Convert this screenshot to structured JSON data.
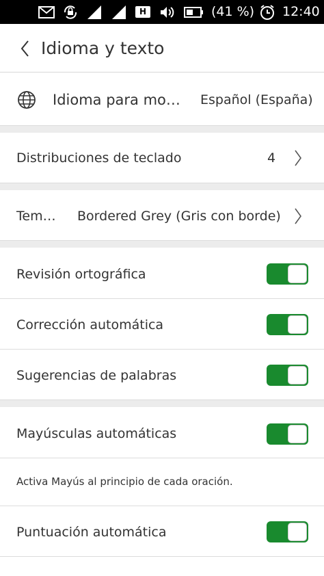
{
  "status_bar": {
    "icons": [
      "mail-icon",
      "rotation-lock-icon",
      "signal-icon",
      "signal-icon",
      "h-network-icon",
      "volume-icon",
      "battery-icon",
      "alarm-icon"
    ],
    "network_badge": "H",
    "battery_text": "(41 %)",
    "time": "12:40"
  },
  "header": {
    "title": "Idioma y texto"
  },
  "display_language": {
    "label": "Idioma para mo…",
    "value": "Español (España)",
    "icon": "globe-icon"
  },
  "keyboard_layouts": {
    "label": "Distribuciones de teclado",
    "count": "4"
  },
  "theme": {
    "label": "Tem…",
    "value": "Bordered Grey (Gris con borde)"
  },
  "toggles": {
    "spell_check": {
      "label": "Revisión ortográfica",
      "on": true
    },
    "auto_correction": {
      "label": "Corrección automática",
      "on": true
    },
    "word_suggestions": {
      "label": "Sugerencias de palabras",
      "on": true
    },
    "auto_caps": {
      "label": "Mayúsculas automáticas",
      "on": true,
      "description": "Activa Mayús al principio de cada oración."
    },
    "auto_punctuation": {
      "label": "Puntuación automática",
      "on": true
    }
  },
  "colors": {
    "toggle_on": "#198a2e",
    "status_bar": "#000000",
    "section_gap": "#ececec"
  }
}
